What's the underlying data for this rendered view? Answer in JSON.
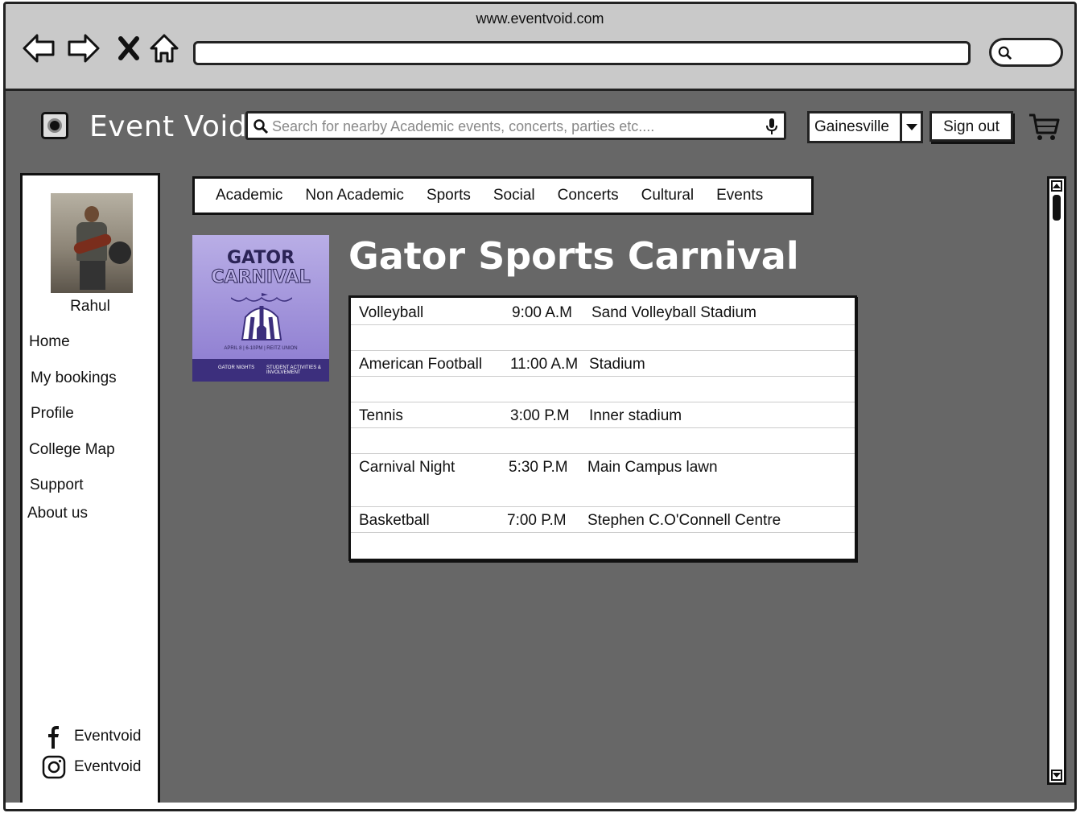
{
  "browser": {
    "url": "www.eventvoid.com"
  },
  "header": {
    "brand": "Event Void",
    "search_placeholder": "Search for nearby Academic events, concerts, parties etc....",
    "city": "Gainesville",
    "signout_label": "Sign out"
  },
  "sidebar": {
    "username": "Rahul",
    "items": [
      {
        "label": "Home"
      },
      {
        "label": "My bookings"
      },
      {
        "label": "Profile"
      },
      {
        "label": "College Map"
      },
      {
        "label": "Support"
      },
      {
        "label": "About us"
      }
    ],
    "social": [
      {
        "icon": "facebook-icon",
        "label": "Eventvoid"
      },
      {
        "icon": "instagram-icon",
        "label": "Eventvoid"
      }
    ]
  },
  "categories": [
    "Academic",
    "Non Academic",
    "Sports",
    "Social",
    "Concerts",
    "Cultural",
    "Events"
  ],
  "poster": {
    "line1": "GATOR",
    "line2": "CARNIVAL",
    "details": "APRIL 8 | 6-10PM | REITZ UNION",
    "footer_left": "GATOR NIGHTS",
    "footer_right": "STUDENT ACTIVITIES & INVOLVEMENT"
  },
  "event": {
    "title": "Gator Sports Carnival",
    "schedule": [
      {
        "name": "Volleyball",
        "time": "9:00 A.M",
        "venue": "Sand Volleyball Stadium"
      },
      {
        "name": "American Football",
        "time": "11:00 A.M",
        "venue": "Stadium"
      },
      {
        "name": "Tennis",
        "time": "3:00 P.M",
        "venue": "Inner stadium"
      },
      {
        "name": "Carnival Night",
        "time": "5:30 P.M",
        "venue": "Main Campus lawn"
      },
      {
        "name": "Basketball",
        "time": "7:00 P.M",
        "venue": "Stephen C.O'Connell Centre"
      }
    ]
  },
  "colors": {
    "page_bg": "#676767",
    "chrome_bg": "#c9c9c9",
    "poster_purple": "#8a79cf"
  }
}
